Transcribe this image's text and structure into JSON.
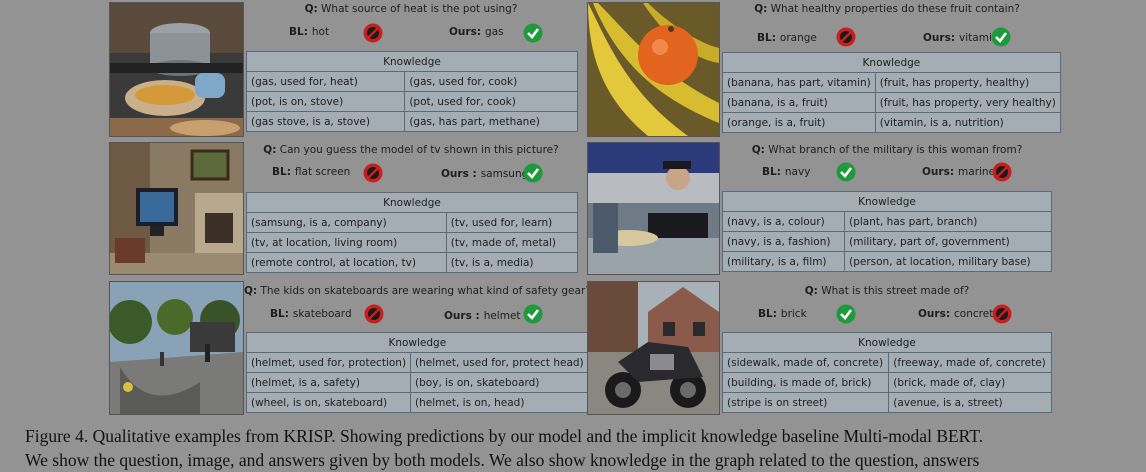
{
  "panels": [
    {
      "question_label": "Q:",
      "question": "What source of heat is the pot using?",
      "bl_label": "BL:",
      "bl_answer": "hot",
      "bl_correct": false,
      "ours_label": "Ours:",
      "ours_answer": "gas",
      "ours_correct": true,
      "knowledge_header": "Knowledge",
      "rows": [
        [
          "(gas, used for, heat)",
          "(gas, used for, cook)"
        ],
        [
          "(pot, is on, stove)",
          "(pot, used for, cook)"
        ],
        [
          "(gas stove, is a, stove)",
          "(gas, has part, methane)"
        ]
      ],
      "image": "kitchen-pot-image"
    },
    {
      "question_label": "Q:",
      "question": "What healthy properties do these fruit contain?",
      "bl_label": "BL:",
      "bl_answer": "orange",
      "bl_correct": false,
      "ours_label": "Ours:",
      "ours_answer": "vitamin",
      "ours_correct": true,
      "knowledge_header": "Knowledge",
      "rows": [
        [
          "(banana, has part, vitamin)",
          "(fruit, has property, healthy)"
        ],
        [
          "(banana, is a, fruit)",
          "(fruit, has property, very healthy)"
        ],
        [
          "(orange, is a, fruit)",
          "(vitamin, is a, nutrition)"
        ]
      ],
      "image": "banana-orange-image"
    },
    {
      "question_label": "Q:",
      "question": "Can you guess the model of tv shown in this picture?",
      "bl_label": "BL:",
      "bl_answer": "flat screen",
      "bl_correct": false,
      "ours_label": "Ours :",
      "ours_answer": "samsung",
      "ours_correct": true,
      "knowledge_header": "Knowledge",
      "rows": [
        [
          "(samsung, is a, company)",
          "(tv, used for, learn)"
        ],
        [
          "(tv, at location, living room)",
          "(tv, made of, metal)"
        ],
        [
          "(remote control, at location, tv)",
          "(tv, is a, media)"
        ]
      ],
      "image": "living-room-tv-image"
    },
    {
      "question_label": "Q:",
      "question": "What branch of the military is this woman from?",
      "bl_label": "BL:",
      "bl_answer": "navy",
      "bl_correct": true,
      "ours_label": "Ours:",
      "ours_answer": "marine",
      "ours_correct": false,
      "knowledge_header": "Knowledge",
      "rows": [
        [
          "(navy, is a, colour)",
          "(plant, has part, branch)"
        ],
        [
          "(navy, is a, fashion)",
          "(military, part of, government)"
        ],
        [
          "(military, is a, film)",
          "(person, at location, military base)"
        ]
      ],
      "image": "military-woman-image"
    },
    {
      "question_label": "Q:",
      "question": "The kids on skateboards are wearing what kind of safety gear?",
      "bl_label": "BL:",
      "bl_answer": "skateboard",
      "bl_correct": false,
      "ours_label": "Ours :",
      "ours_answer": "helmet",
      "ours_correct": true,
      "knowledge_header": "Knowledge",
      "rows": [
        [
          "(helmet, used for, protection)",
          "(helmet, used for, protect head)"
        ],
        [
          "(helmet, is a, safety)",
          "(boy, is on, skateboard)"
        ],
        [
          "(wheel, is on, skateboard)",
          "(helmet, is on, head)"
        ]
      ],
      "image": "skatepark-image"
    },
    {
      "question_label": "Q:",
      "question": "What is this street made of?",
      "bl_label": "BL:",
      "bl_answer": "brick",
      "bl_correct": true,
      "ours_label": "Ours:",
      "ours_answer": "concrete",
      "ours_correct": false,
      "knowledge_header": "Knowledge",
      "rows": [
        [
          "(sidewalk, made of, concrete)",
          "(freeway, made of, concrete)"
        ],
        [
          "(building, is made of, brick)",
          "(brick, made of, clay)"
        ],
        [
          "(stripe is on street)",
          "(avenue, is a, street)"
        ]
      ],
      "image": "motorcycle-street-image"
    }
  ],
  "caption": {
    "line1": "Figure 4. Qualitative examples from KRISP. Showing predictions by our model and the implicit knowledge baseline Multi-modal BERT.",
    "line2": "We show the question, image, and answers given by both models. We also show knowledge in the graph related to the question, answers"
  },
  "colors": {
    "background": "#939393",
    "correct": "#1e9a3c",
    "wrong": "#c81e1e",
    "table": "#a4acb4"
  }
}
